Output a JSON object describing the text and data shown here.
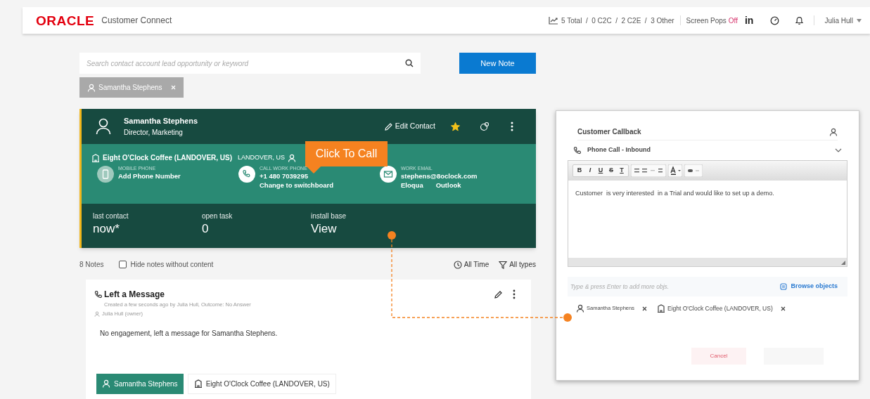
{
  "header": {
    "logo": "ORACLE",
    "app_name": "Customer Connect",
    "stats": "5 Total  /  0 C2C  /  2 C2E  /  3 Other",
    "screen_pops": {
      "label": "Screen Pops",
      "value": "Off",
      "on": false
    },
    "linkedin": "in",
    "user": "Julia Hull"
  },
  "search": {
    "placeholder": "Search contact account lead opportunity or keyword"
  },
  "new_note_button": "New Note",
  "filter_chip": "Samantha Stephens",
  "contact_card": {
    "name": "Samantha Stephens",
    "title": "Director, Marketing",
    "edit": "Edit Contact",
    "starred": true,
    "account": "Eight O'Clock Coffee (LANDOVER, US)",
    "location": "LANDOVER, US",
    "channels": [
      {
        "kind": "mobile",
        "label": "MOBILE PHONE",
        "lines": [
          "Add Phone Number"
        ]
      },
      {
        "kind": "phone",
        "label": "CALL WORK PHONE",
        "lines": [
          "+1 480 7039295",
          "Change to switchboard"
        ]
      },
      {
        "kind": "email",
        "label": "WORK EMAIL",
        "lines": [
          "stephens@8oclock.com"
        ],
        "links": [
          "Eloqua",
          "Outlook"
        ]
      }
    ],
    "stats": [
      {
        "label": "last contact",
        "value": "now*"
      },
      {
        "label": "open task",
        "value": "0"
      },
      {
        "label": "install base",
        "value": "View"
      }
    ]
  },
  "callout": "Click To Call",
  "notes": {
    "count": "8 Notes",
    "hide_empty": {
      "label": "Hide notes without content",
      "checked": false
    },
    "filters": [
      {
        "kind": "time",
        "label": "All Time"
      },
      {
        "kind": "type",
        "label": "All types"
      }
    ],
    "note": {
      "title": "Left a Message",
      "meta": "Created a few seconds ago by Julia Hull, Outcome: No Answer",
      "owner": "Julia Hull (owner)",
      "body": "No engagement, left a message for Samantha Stephens."
    },
    "tags": [
      {
        "kind": "person",
        "label": "Samantha Stephens",
        "selected": true
      },
      {
        "kind": "account",
        "label": "Eight O'Clock Coffee (LANDOVER, US)",
        "selected": false
      }
    ]
  },
  "panel": {
    "subject": "Customer Callback",
    "activity_type": "Phone Call - Inbound",
    "toolbar": [
      "B",
      "I",
      "U",
      "S",
      "T"
    ],
    "body": "Customer  is very interested  in a Trial and would like to set up a demo.",
    "objects_placeholder": "Type & press Enter to add more objs.",
    "browse": "Browse objects",
    "objects": [
      {
        "kind": "person",
        "label": "Samantha Stephens"
      },
      {
        "kind": "account",
        "label": "Eight O'Clock Coffee (LANDOVER, US)"
      }
    ],
    "cancel": "Cancel"
  }
}
